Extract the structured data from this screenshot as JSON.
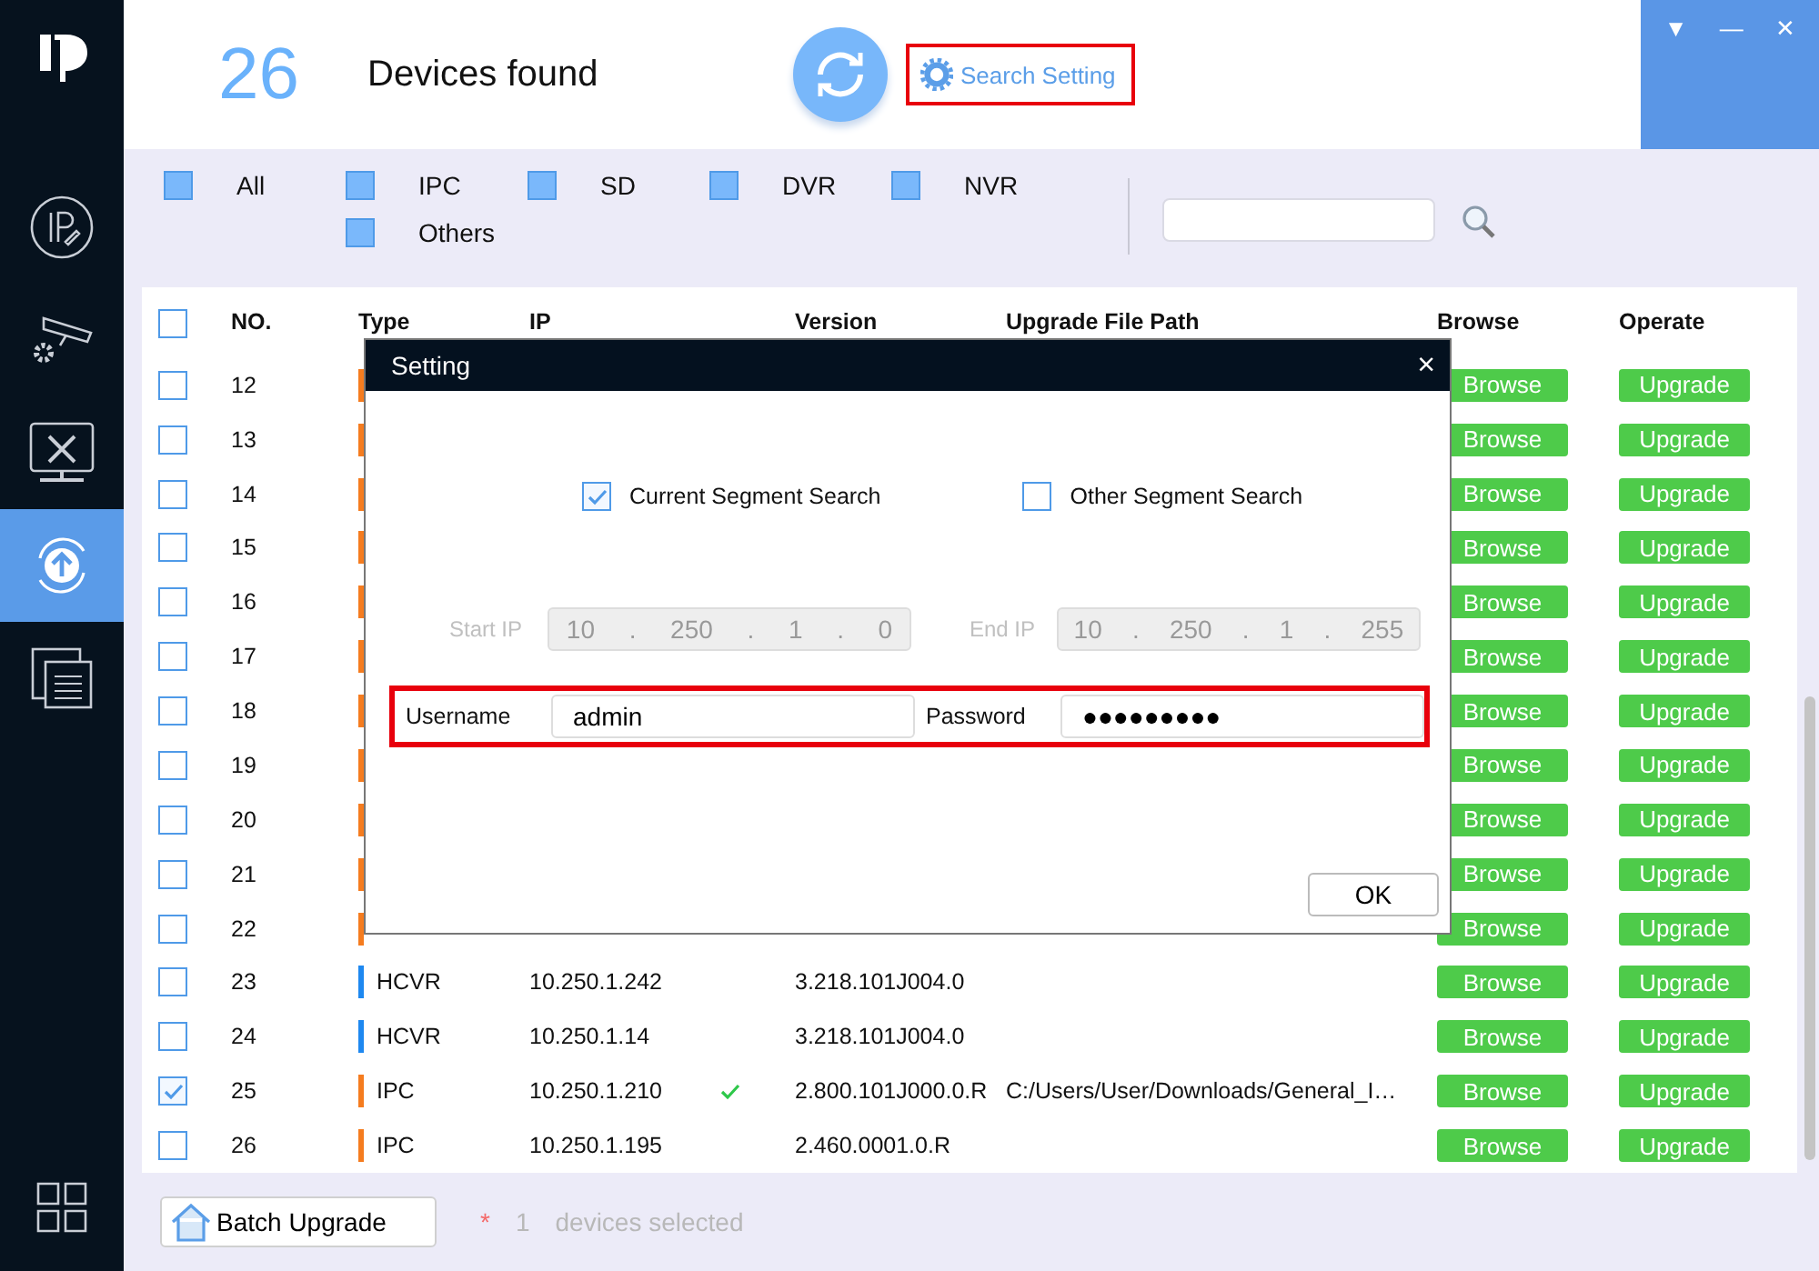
{
  "header": {
    "count": "26",
    "title": "Devices found",
    "search_setting": "Search Setting"
  },
  "window_controls": [
    "▼",
    "—",
    "✕"
  ],
  "sidebar": {
    "items": [
      {
        "kind": "ip",
        "selected": false
      },
      {
        "kind": "camera",
        "selected": false
      },
      {
        "kind": "tools",
        "selected": false
      },
      {
        "kind": "upgrade",
        "selected": true
      },
      {
        "kind": "windows",
        "selected": false
      }
    ]
  },
  "filters": [
    {
      "label": "All",
      "checked": true
    },
    {
      "label": "IPC",
      "checked": true
    },
    {
      "label": "SD",
      "checked": true
    },
    {
      "label": "DVR",
      "checked": true
    },
    {
      "label": "NVR",
      "checked": true
    },
    {
      "label": "Others",
      "checked": true
    }
  ],
  "table": {
    "columns": [
      "NO.",
      "Type",
      "IP",
      "Version",
      "Upgrade File Path",
      "Browse",
      "Operate"
    ],
    "header_checked": false,
    "rows": [
      {
        "no": "12",
        "checked": false,
        "color": "#f57c1f",
        "browse": "Browse",
        "operate": "Upgrade",
        "verified": false
      },
      {
        "no": "13",
        "checked": false,
        "color": "#f57c1f",
        "browse": "Browse",
        "operate": "Upgrade",
        "verified": false
      },
      {
        "no": "14",
        "checked": false,
        "color": "#f57c1f",
        "browse": "Browse",
        "operate": "Upgrade",
        "verified": false
      },
      {
        "no": "15",
        "checked": false,
        "color": "#f57c1f",
        "browse": "Browse",
        "operate": "Upgrade",
        "verified": false
      },
      {
        "no": "16",
        "checked": false,
        "color": "#f57c1f",
        "browse": "Browse",
        "operate": "Upgrade",
        "verified": false
      },
      {
        "no": "17",
        "checked": false,
        "color": "#f57c1f",
        "browse": "Browse",
        "operate": "Upgrade",
        "verified": false
      },
      {
        "no": "18",
        "checked": false,
        "color": "#f57c1f",
        "browse": "Browse",
        "operate": "Upgrade",
        "verified": false
      },
      {
        "no": "19",
        "checked": false,
        "color": "#f57c1f",
        "browse": "Browse",
        "operate": "Upgrade",
        "verified": false
      },
      {
        "no": "20",
        "checked": false,
        "color": "#f57c1f",
        "browse": "Browse",
        "operate": "Upgrade",
        "verified": false
      },
      {
        "no": "21",
        "checked": false,
        "color": "#f57c1f",
        "browse": "Browse",
        "operate": "Upgrade",
        "verified": false
      },
      {
        "no": "22",
        "checked": false,
        "color": "#f57c1f",
        "browse": "Browse",
        "operate": "Upgrade",
        "verified": false
      },
      {
        "no": "23",
        "checked": false,
        "color": "#1e88f0",
        "type": "HCVR",
        "ip": "10.250.1.242",
        "version": "3.218.101J004.0",
        "browse": "Browse",
        "operate": "Upgrade",
        "verified": false
      },
      {
        "no": "24",
        "checked": false,
        "color": "#1e88f0",
        "type": "HCVR",
        "ip": "10.250.1.14",
        "version": "3.218.101J004.0",
        "browse": "Browse",
        "operate": "Upgrade",
        "verified": false
      },
      {
        "no": "25",
        "checked": true,
        "color": "#f57c1f",
        "type": "IPC",
        "ip": "10.250.1.210",
        "version": "2.800.101J000.0.R",
        "path": "C:/Users/User/Downloads/General_I…",
        "browse": "Browse",
        "operate": "Upgrade",
        "verified": true
      },
      {
        "no": "26",
        "checked": false,
        "color": "#f57c1f",
        "type": "IPC",
        "ip": "10.250.1.195",
        "version": "2.460.0001.0.R",
        "browse": "Browse",
        "operate": "Upgrade",
        "verified": false
      }
    ]
  },
  "footer": {
    "batch_upgrade": "Batch Upgrade",
    "asterisk": "*",
    "count": "1",
    "selected_text": "devices selected"
  },
  "dialog": {
    "title": "Setting",
    "close": "×",
    "options": [
      {
        "label": "Current Segment Search",
        "checked": true
      },
      {
        "label": "Other Segment Search",
        "checked": false
      }
    ],
    "ip_ranges": [
      {
        "label": "Start IP",
        "octets": [
          "10",
          "250",
          "1",
          "0"
        ],
        "disabled": true
      },
      {
        "label": "End IP",
        "octets": [
          "10",
          "250",
          "1",
          "255"
        ],
        "disabled": true
      }
    ],
    "separator": ".",
    "username": {
      "label": "Username",
      "value": "admin"
    },
    "password": {
      "label": "Password",
      "value": "●●●●●●●●●"
    },
    "ok": "OK"
  }
}
